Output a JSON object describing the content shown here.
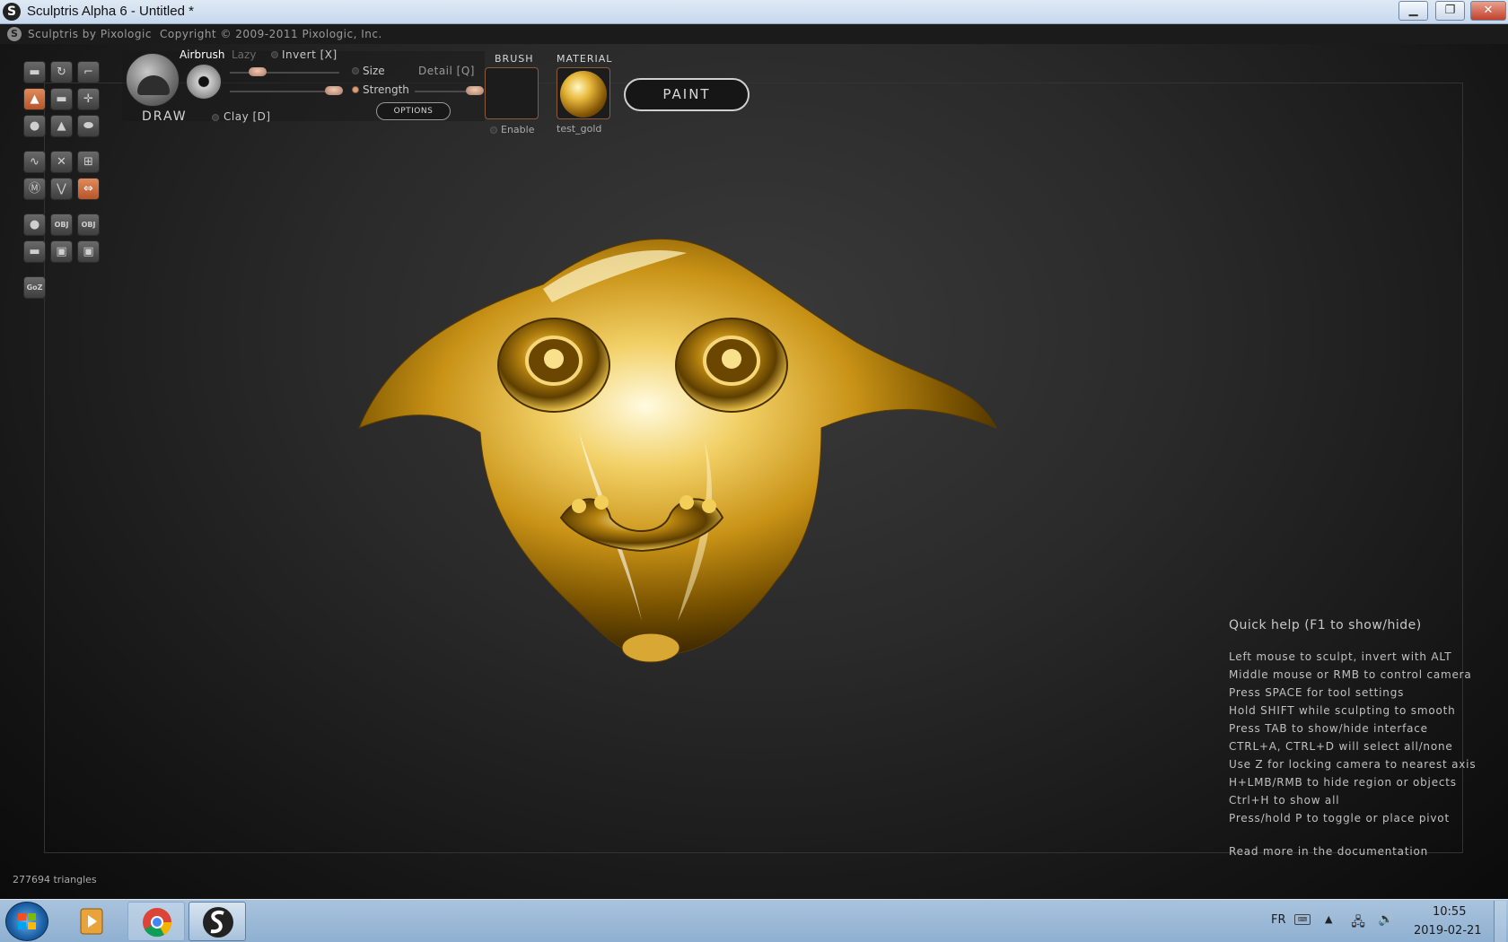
{
  "window": {
    "title": "Sculptris Alpha 6 - Untitled *",
    "minimize_glyph": "▁",
    "maximize_glyph": "❐",
    "close_glyph": "✕"
  },
  "app_header": {
    "name": "Sculptris by Pixologic",
    "copyright": "Copyright © 2009-2011 Pixologic, Inc."
  },
  "toolbar": {
    "tool_icons": [
      "draw-icon",
      "rotate-icon",
      "crop-icon",
      "inflate-icon",
      "flatten-icon",
      "move-icon",
      "pinch-icon",
      "crease-icon",
      "smooth-icon",
      "grab-icon",
      "reduce-brush-icon",
      "mask-icon",
      "symmetry-icon",
      "wireframe-icon",
      "subdivide-icon",
      "reduce-icon",
      "triangle-icon",
      "mirror-icon",
      "new-sphere-icon",
      "import-obj-icon",
      "export-obj-icon",
      "new-plane-icon",
      "save-icon",
      "save-as-icon"
    ],
    "obj_label": "OBJ",
    "goz_label": "GoZ"
  },
  "brush_panel": {
    "tool_name": "DRAW",
    "airbrush": "Airbrush",
    "lazy": "Lazy",
    "invert": "Invert [X]",
    "size": "Size",
    "detail": "Detail [Q]",
    "strength": "Strength",
    "options": "OPTIONS",
    "clay": "Clay [D]",
    "size_level": 0.25,
    "strength_level": 0.95,
    "detail_level": 0.95
  },
  "brush_slot": {
    "heading": "BRUSH",
    "enable": "Enable"
  },
  "material_slot": {
    "heading": "MATERIAL",
    "name": "test_gold"
  },
  "paint_button": "PAINT",
  "quick_help": {
    "title": "Quick help (F1 to show/hide)",
    "lines": [
      "Left mouse to sculpt, invert with ALT",
      "Middle mouse or RMB to control camera",
      "Press SPACE for tool settings",
      "Hold SHIFT while sculpting to smooth",
      "Press TAB to show/hide interface",
      "CTRL+A, CTRL+D will select all/none",
      "Use Z for locking camera to nearest axis",
      "H+LMB/RMB to hide region or objects",
      "Ctrl+H to show all",
      "Press/hold P to toggle or place pivot"
    ],
    "more": "Read more in the documentation"
  },
  "status": {
    "triangles": "277694 triangles"
  },
  "taskbar": {
    "language": "FR",
    "time": "10:55",
    "date": "2019-02-21",
    "items": [
      "windows-start-icon",
      "media-player-icon",
      "chrome-icon",
      "sculptris-icon"
    ]
  },
  "colors": {
    "accent": "#d07040",
    "gold": "#e7b83a",
    "viewport_bg": "#2a2a2a"
  }
}
